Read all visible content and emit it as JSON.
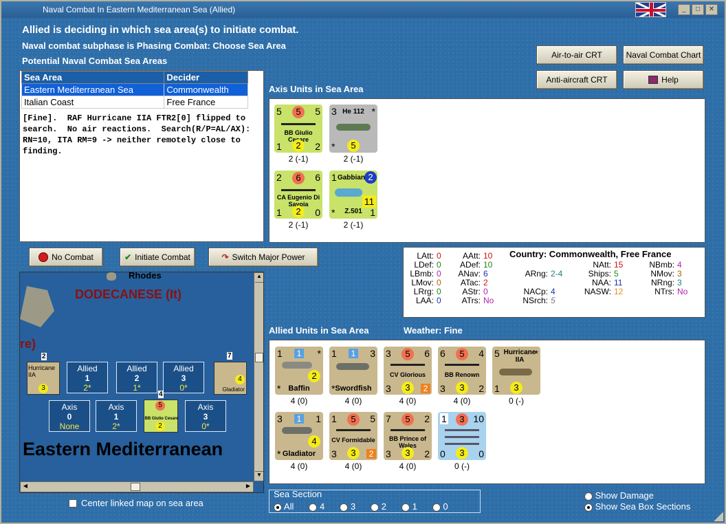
{
  "window": {
    "title": "Naval Combat In Eastern Mediterranean Sea (Allied)"
  },
  "header": {
    "line1": "Allied is deciding in which sea area(s) to initiate combat.",
    "line2": "Naval combat subphase is Phasing Combat: Choose Sea Area",
    "line3": "Potential Naval Combat Sea Areas"
  },
  "buttons": {
    "air_to_air": "Air-to-air CRT",
    "naval_chart": "Naval Combat Chart",
    "anti_aircraft": "Anti-aircraft CRT",
    "help": "Help",
    "no_combat": "No Combat",
    "initiate": "Initiate Combat",
    "switch": "Switch Major Power"
  },
  "sea_table": {
    "headers": [
      "Sea Area",
      "Decider"
    ],
    "rows": [
      [
        "Eastern Mediterranean Sea",
        "Commonwealth"
      ],
      [
        "Italian Coast",
        "Free France"
      ]
    ]
  },
  "log": "[Fine].  RAF Hurricane IIA FTR2[0] flipped to\nsearch.  No air reactions.  Search(R/P=AL/AX):\nRN=10, ITA RM=9 -> neither remotely close to\nfinding.",
  "axis": {
    "title": "Axis Units in Sea Area",
    "units": [
      {
        "name": "BB Giulio Cesare",
        "tl": "5",
        "tc": "5",
        "tr": "5",
        "bl": "1",
        "bc": "2",
        "br": "2",
        "label": "2 (-1)"
      },
      {
        "name": "He 112",
        "tl": "3",
        "tc": "",
        "tr": "*",
        "bl": "*",
        "bc": "5",
        "br": "",
        "label": "2 (-1)"
      },
      {
        "name": "CA Eugenio Di Savoia",
        "tl": "2",
        "tc": "6",
        "tr": "6",
        "bl": "1",
        "bc": "2",
        "br": "0",
        "label": "2 (-1)"
      },
      {
        "name": "Gabbiano",
        "sub": "Z.501",
        "tl": "1",
        "tc": "2",
        "tr": "",
        "bl": "*",
        "bc": "11",
        "br": "1",
        "label": "2 (-1)"
      }
    ]
  },
  "stats": {
    "country": "Country: Commonwealth, Free France",
    "col1": [
      [
        "LAtt:",
        "0"
      ],
      [
        "LDef:",
        "0"
      ],
      [
        "LBmb:",
        "0"
      ],
      [
        "LMov:",
        "0"
      ],
      [
        "LRrg:",
        "0"
      ],
      [
        "LAA:",
        "0"
      ]
    ],
    "col2": [
      [
        "AAtt:",
        "10"
      ],
      [
        "ADef:",
        "10"
      ],
      [
        "ANav:",
        "6"
      ],
      [
        "ATac:",
        "2"
      ],
      [
        "AStr:",
        "0"
      ],
      [
        "ATrs:",
        "No"
      ]
    ],
    "col3": [
      [
        "ARng:",
        "2-4"
      ],
      [
        "NACp:",
        "4"
      ],
      [
        "NSrch:",
        "5"
      ]
    ],
    "col4": [
      [
        "NAtt:",
        "15"
      ],
      [
        "Ships:",
        "5"
      ],
      [
        "NAA:",
        "11"
      ],
      [
        "NASW:",
        "12"
      ]
    ],
    "col5": [
      [
        "NBmb:",
        "4"
      ],
      [
        "NMov:",
        "3"
      ],
      [
        "NRng:",
        "3"
      ],
      [
        "NTrs:",
        "No"
      ]
    ]
  },
  "allied": {
    "title": "Allied Units in Sea Area",
    "weather": "Weather:  Fine",
    "units": [
      {
        "name": "Baffin",
        "tl": "1",
        "tc": "1",
        "tr": "*",
        "bl": "*",
        "bc": "2",
        "br": "",
        "label": "4 (0)"
      },
      {
        "name": "Swordfish",
        "tl": "1",
        "tc": "1",
        "tr": "3",
        "bl": "*",
        "bc": "",
        "br": "",
        "label": "4 (0)"
      },
      {
        "name": "CV Glorious",
        "tl": "3",
        "tc": "5",
        "tr": "6",
        "bl": "3",
        "bc": "3",
        "br": "2",
        "label": "4 (0)"
      },
      {
        "name": "BB Renown",
        "tl": "6",
        "tc": "5",
        "tr": "4",
        "bl": "3",
        "bc": "3",
        "br": "2",
        "label": "4 (0)"
      },
      {
        "name": "Hurricane IIA",
        "tl": "5",
        "tc": "",
        "tr": "*",
        "bl": "1",
        "bc": "3",
        "br": "",
        "label": "0 (-)"
      },
      {
        "name": "Gladiator",
        "tl": "3",
        "tc": "1",
        "tr": "1",
        "bl": "*",
        "bc": "4",
        "br": "",
        "label": "4 (0)"
      },
      {
        "name": "CV Formidable",
        "tl": "1",
        "tc": "5",
        "tr": "5",
        "bl": "3",
        "bc": "3",
        "br": "2",
        "label": "4 (0)"
      },
      {
        "name": "BB Prince of Wales",
        "tl": "7",
        "tc": "5",
        "tr": "2",
        "bl": "3",
        "bc": "3",
        "br": "2",
        "label": "4 (0)"
      },
      {
        "name": "",
        "tl": "1",
        "tc": "3",
        "tr": "10",
        "bl": "0",
        "bc": "3",
        "br": "0",
        "label": "0 (-)"
      }
    ]
  },
  "map": {
    "rhodes": "Rhodes",
    "dodecanese": "DODECANESE (It)",
    "re": "re)",
    "sea_name": "Eastern Mediterranean",
    "allied_boxes": [
      [
        "Allied",
        "1",
        "2*"
      ],
      [
        "Allied",
        "2",
        "1*"
      ],
      [
        "Allied",
        "3",
        "0*"
      ]
    ],
    "axis_boxes": [
      [
        "Axis",
        "0",
        "None"
      ],
      [
        "Axis",
        "1",
        "2*"
      ],
      [
        "Axis",
        "3",
        "0*"
      ]
    ],
    "badges": [
      "2",
      "7",
      "4"
    ],
    "hurricane": "Hurricane IIA",
    "gladiator": "Gladiator",
    "giulio": "BB Giulio Cesare"
  },
  "bottom": {
    "center_map": "Center linked map on sea area",
    "sea_section": "Sea Section",
    "sections": [
      "All",
      "4",
      "3",
      "2",
      "1",
      "0"
    ],
    "show_damage": "Show Damage",
    "show_boxes": "Show Sea Box Sections"
  },
  "colors": {
    "bg": "#2f6fa9",
    "axis_counter": "#c8e26a",
    "allied_counter": "#c9b88e",
    "sel": "#1060d8"
  }
}
